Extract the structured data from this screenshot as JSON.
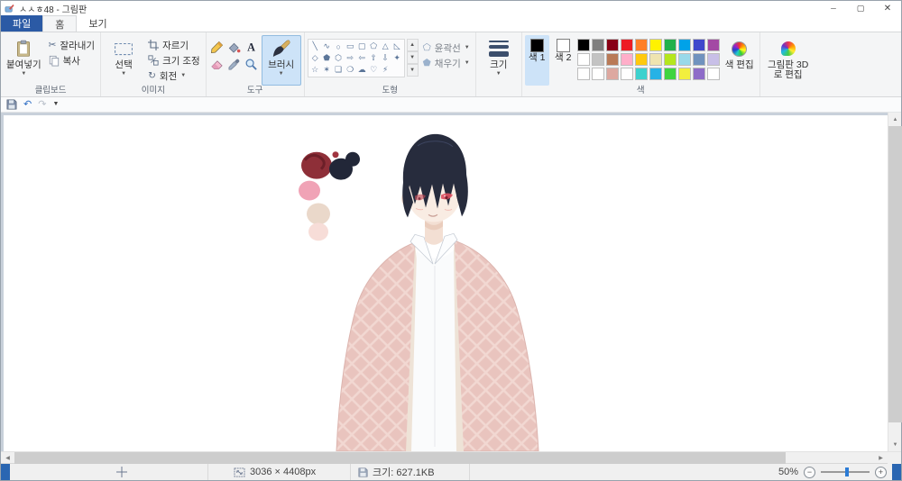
{
  "titlebar": {
    "title": "ㅅㅅㅎ48 - 그림판"
  },
  "tabs": {
    "file": "파일",
    "home": "홈",
    "view": "보기"
  },
  "ribbon": {
    "clipboard": {
      "label": "클립보드",
      "paste": "붙여넣기",
      "cut": "잘라내기",
      "copy": "복사"
    },
    "image": {
      "label": "이미지",
      "select": "선택",
      "crop": "자르기",
      "resize": "크기 조정",
      "rotate": "회전"
    },
    "tools": {
      "label": "도구",
      "brush": "브러시",
      "names": [
        "pencil",
        "fill-with-color",
        "text",
        "eraser",
        "color-picker",
        "magnifier"
      ]
    },
    "shapes": {
      "label": "도형",
      "outline": "윤곽선",
      "fill": "채우기",
      "items": [
        {
          "name": "line",
          "glyph": "╲"
        },
        {
          "name": "curve",
          "glyph": "∿"
        },
        {
          "name": "oval",
          "glyph": "○"
        },
        {
          "name": "rectangle",
          "glyph": "▭"
        },
        {
          "name": "rounded-rectangle",
          "glyph": "▢"
        },
        {
          "name": "polygon",
          "glyph": "⬠"
        },
        {
          "name": "triangle",
          "glyph": "△"
        },
        {
          "name": "right-triangle",
          "glyph": "◺"
        },
        {
          "name": "diamond",
          "glyph": "◇"
        },
        {
          "name": "pentagon",
          "glyph": "⬟"
        },
        {
          "name": "hexagon",
          "glyph": "⬡"
        },
        {
          "name": "right-arrow",
          "glyph": "⇨"
        },
        {
          "name": "left-arrow",
          "glyph": "⇦"
        },
        {
          "name": "up-arrow",
          "glyph": "⇧"
        },
        {
          "name": "down-arrow",
          "glyph": "⇩"
        },
        {
          "name": "four-point-star",
          "glyph": "✦"
        },
        {
          "name": "five-point-star",
          "glyph": "☆"
        },
        {
          "name": "six-point-star",
          "glyph": "✶"
        },
        {
          "name": "rounded-callout",
          "glyph": "❏"
        },
        {
          "name": "oval-callout",
          "glyph": "❍"
        },
        {
          "name": "cloud-callout",
          "glyph": "☁"
        },
        {
          "name": "heart",
          "glyph": "♡"
        },
        {
          "name": "lightning",
          "glyph": "⚡"
        }
      ]
    },
    "size": {
      "label": "크기"
    },
    "colors": {
      "label": "색",
      "color1_label": "색 1",
      "color2_label": "색 2",
      "edit_label": "색 편집",
      "color1": "#000000",
      "color2": "#FFFFFF",
      "palette": [
        "#000000",
        "#7F7F7F",
        "#880015",
        "#ED1C24",
        "#FF7F27",
        "#FFF200",
        "#22B14C",
        "#00A2E8",
        "#3F48CC",
        "#A349A4",
        "#FFFFFF",
        "#C3C3C3",
        "#B97A57",
        "#FFAEC9",
        "#FFC90E",
        "#EFE4B0",
        "#B5E61D",
        "#99D9EA",
        "#7092BE",
        "#C8BFE7",
        "#FFFFFF",
        "#FFFFFF",
        "#DDA8A0",
        "#FFFFFF",
        "#3DD1CE",
        "#27B2E6",
        "#3FD43F",
        "#F2EF3E",
        "#8E6CC8",
        "#FFFFFF"
      ]
    },
    "paint3d": {
      "label": "그림판 3D로 편집"
    }
  },
  "statusbar": {
    "image_size": "3036 × 4408px",
    "file_size": "크기: 627.1KB",
    "zoom": "50%"
  }
}
